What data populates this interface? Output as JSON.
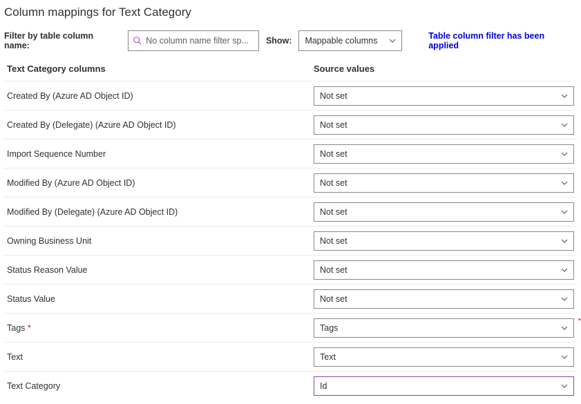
{
  "title": "Column mappings for Text Category",
  "filter": {
    "label": "Filter by table column name:",
    "placeholder": "No column name filter sp...",
    "showLabel": "Show:",
    "showValue": "Mappable columns",
    "appliedMsg": "Table column filter has been applied"
  },
  "headers": {
    "left": "Text Category columns",
    "right": "Source values"
  },
  "rows": [
    {
      "label": "Created By (Azure AD Object ID)",
      "value": "Not set",
      "required": false,
      "highlighted": false
    },
    {
      "label": "Created By (Delegate) (Azure AD Object ID)",
      "value": "Not set",
      "required": false,
      "highlighted": false
    },
    {
      "label": "Import Sequence Number",
      "value": "Not set",
      "required": false,
      "highlighted": false
    },
    {
      "label": "Modified By (Azure AD Object ID)",
      "value": "Not set",
      "required": false,
      "highlighted": false
    },
    {
      "label": "Modified By (Delegate) (Azure AD Object ID)",
      "value": "Not set",
      "required": false,
      "highlighted": false
    },
    {
      "label": "Owning Business Unit",
      "value": "Not set",
      "required": false,
      "highlighted": false
    },
    {
      "label": "Status Reason Value",
      "value": "Not set",
      "required": false,
      "highlighted": false
    },
    {
      "label": "Status Value",
      "value": "Not set",
      "required": false,
      "highlighted": false
    },
    {
      "label": "Tags",
      "value": "Tags",
      "required": true,
      "highlighted": false,
      "outerMark": true
    },
    {
      "label": "Text",
      "value": "Text",
      "required": false,
      "highlighted": false
    },
    {
      "label": "Text Category",
      "value": "Id",
      "required": false,
      "highlighted": true
    }
  ]
}
